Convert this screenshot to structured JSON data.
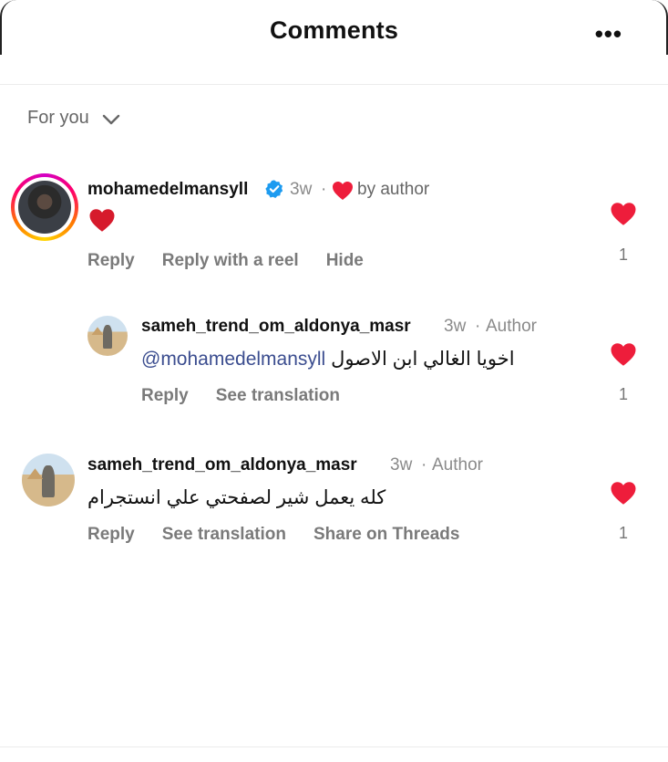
{
  "header": {
    "title": "Comments",
    "more_label": "•••"
  },
  "sort": {
    "label": "For you"
  },
  "colors": {
    "heart": "#ee1d3b",
    "verified": "#1d9bf0",
    "mention": "#3b4d8f"
  },
  "comments": [
    {
      "username": "mohamedelmansyll",
      "verified": true,
      "time": "3w",
      "sep": "·",
      "liked_by": "by author",
      "text": "",
      "actions": [
        "Reply",
        "Reply with a reel",
        "Hide"
      ],
      "likes": "1"
    },
    {
      "username": "sameh_trend_om_aldonya_masr",
      "time": "3w",
      "sep": "·",
      "tag": "Author",
      "mention": "@mohamedelmansyll",
      "text": "اخويا الغالي ابن الاصول",
      "actions": [
        "Reply",
        "See translation"
      ],
      "likes": "1"
    },
    {
      "username": "sameh_trend_om_aldonya_masr",
      "time": "3w",
      "sep": "·",
      "tag": "Author",
      "text": "كله يعمل شير لصفحتي علي انستجرام",
      "actions": [
        "Reply",
        "See translation",
        "Share on Threads"
      ],
      "likes": "1"
    }
  ]
}
